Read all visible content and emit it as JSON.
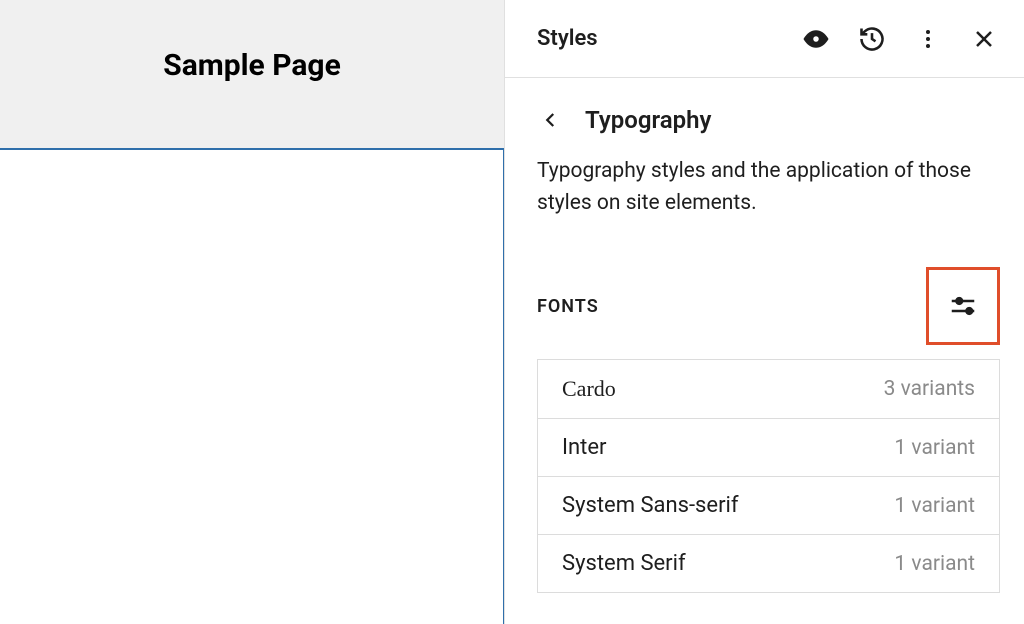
{
  "preview": {
    "title": "Sample Page"
  },
  "sidebar": {
    "header_title": "Styles",
    "section_title": "Typography",
    "description": "Typography styles and the application of those styles on site elements.",
    "fonts_label": "Fonts",
    "fonts": [
      {
        "name": "Cardo",
        "variants": "3 variants",
        "serif": true
      },
      {
        "name": "Inter",
        "variants": "1 variant",
        "serif": false
      },
      {
        "name": "System Sans-serif",
        "variants": "1 variant",
        "serif": false
      },
      {
        "name": "System Serif",
        "variants": "1 variant",
        "serif": false
      }
    ]
  }
}
